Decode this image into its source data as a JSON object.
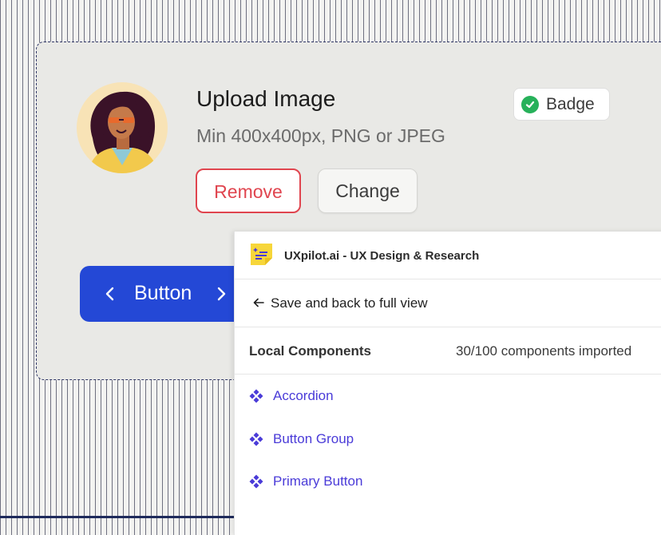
{
  "upload": {
    "title": "Upload Image",
    "subtitle": "Min 400x400px, PNG or JPEG",
    "remove_label": "Remove",
    "change_label": "Change"
  },
  "badge": {
    "label": "Badge",
    "icon": "check-circle-icon",
    "color": "#27b15a"
  },
  "nav_button": {
    "label": "Button",
    "prev_icon": "chevron-left-icon",
    "next_icon": "chevron-right-icon",
    "color": "#2448d6"
  },
  "panel": {
    "plugin_name": "UXpilot.ai - UX Design & Research",
    "back_label": "Save and back to full view",
    "section_title": "Local Components",
    "section_count": "30/100 components imported",
    "components": [
      {
        "label": "Accordion"
      },
      {
        "label": "Button Group"
      },
      {
        "label": "Primary Button"
      }
    ],
    "accent_color": "#4a3bd8"
  }
}
